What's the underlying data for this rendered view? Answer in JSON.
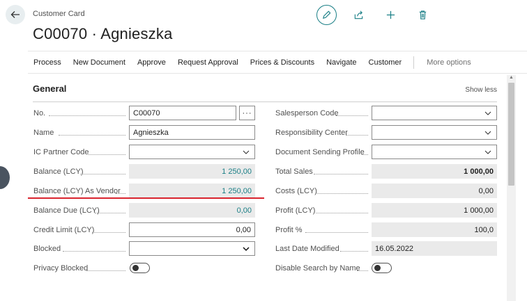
{
  "header": {
    "caption": "Customer Card",
    "title": "C00070 · Agnieszka",
    "actions": [
      "edit-icon",
      "share-icon",
      "add-icon",
      "delete-icon"
    ]
  },
  "menu": {
    "items": [
      "Process",
      "New Document",
      "Approve",
      "Request Approval",
      "Prices & Discounts",
      "Navigate",
      "Customer"
    ],
    "more": "More options"
  },
  "general": {
    "title": "General",
    "show_less": "Show less",
    "left": {
      "no": {
        "label": "No.",
        "value": "C00070",
        "lookup": "···"
      },
      "name": {
        "label": "Name",
        "value": "Agnieszka"
      },
      "ic_partner": {
        "label": "IC Partner Code",
        "value": ""
      },
      "balance": {
        "label": "Balance (LCY)",
        "value": "1 250,00"
      },
      "balance_vendor": {
        "label": "Balance (LCY) As Vendor",
        "value": "1 250,00"
      },
      "balance_due": {
        "label": "Balance Due (LCY)",
        "value": "0,00"
      },
      "credit_limit": {
        "label": "Credit Limit (LCY)",
        "value": "0,00"
      },
      "blocked": {
        "label": "Blocked",
        "value": ""
      },
      "privacy_blocked": {
        "label": "Privacy Blocked",
        "value": false
      }
    },
    "right": {
      "salesperson": {
        "label": "Salesperson Code",
        "value": ""
      },
      "responsibility": {
        "label": "Responsibility Center",
        "value": ""
      },
      "doc_sending": {
        "label": "Document Sending Profile",
        "value": ""
      },
      "total_sales": {
        "label": "Total Sales",
        "value": "1 000,00"
      },
      "costs": {
        "label": "Costs (LCY)",
        "value": "0,00"
      },
      "profit": {
        "label": "Profit (LCY)",
        "value": "1 000,00"
      },
      "profit_pct": {
        "label": "Profit %",
        "value": "100,0"
      },
      "last_modified": {
        "label": "Last Date Modified",
        "value": "16.05.2022"
      },
      "disable_search": {
        "label": "Disable Search by Name",
        "value": false
      }
    }
  },
  "colors": {
    "accent": "#1a7f86",
    "highlight_line": "#d9242e"
  }
}
